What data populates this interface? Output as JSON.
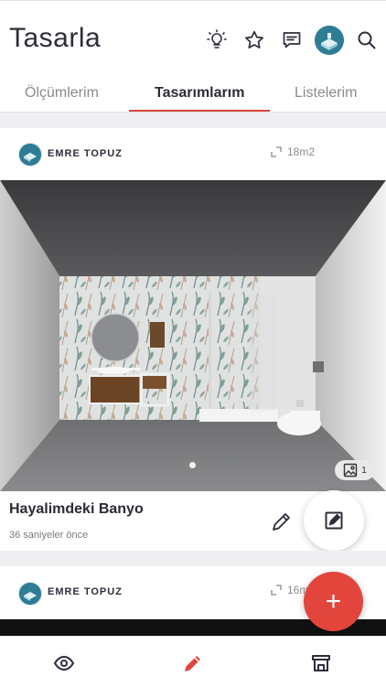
{
  "app": {
    "title": "Tasarla"
  },
  "header_icons": [
    "lightbulb-icon",
    "star-icon",
    "message-icon",
    "user-avatar",
    "search-icon"
  ],
  "tabs": [
    {
      "label": "Ölçümlerim",
      "active": false
    },
    {
      "label": "Tasarımlarım",
      "active": true
    },
    {
      "label": "Listelerim",
      "active": false
    }
  ],
  "designs": [
    {
      "user": "EMRE TOPUZ",
      "size": "18m2",
      "title": "Hayalimdeki Banyo",
      "time": "36 saniyeler önce",
      "image_count": "1",
      "carousel_pages": 1
    },
    {
      "user": "EMRE TOPUZ",
      "size": "16m"
    }
  ],
  "fab": {
    "add_label": "+"
  },
  "bottom_nav": [
    {
      "icon": "eye-icon",
      "active": false
    },
    {
      "icon": "pencil-icon",
      "active": true
    },
    {
      "icon": "store-icon",
      "active": false
    }
  ],
  "colors": {
    "accent": "#e2453b",
    "text": "#2f2d3a",
    "muted": "#8a8a90"
  }
}
